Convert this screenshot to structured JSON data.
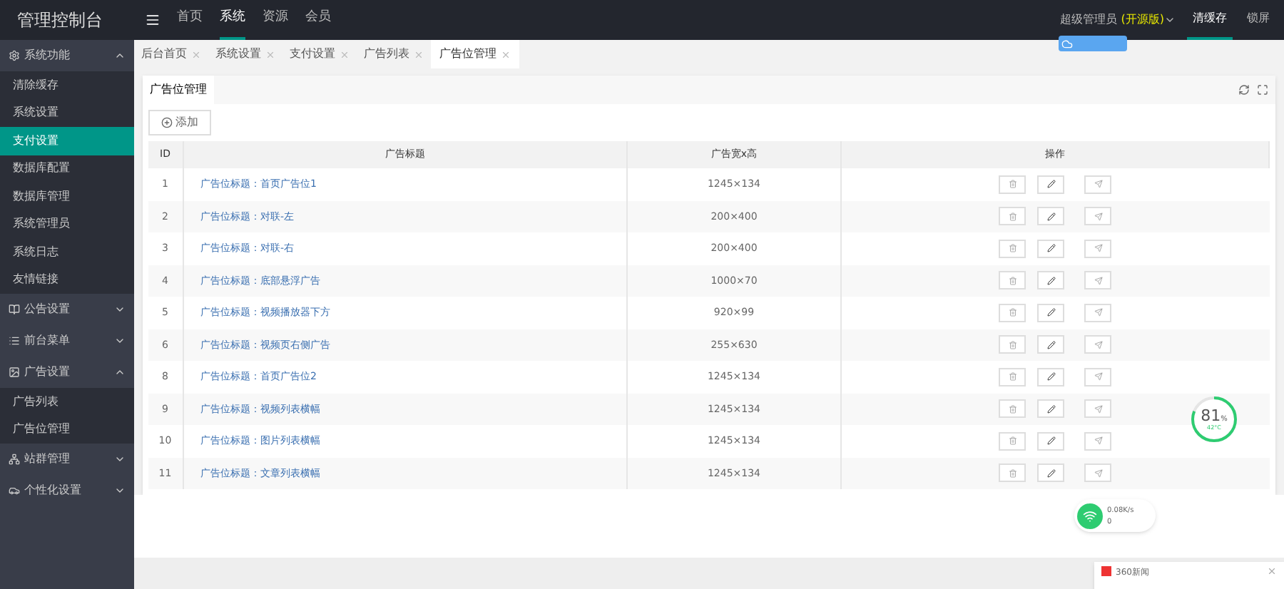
{
  "app_title": "管理控制台",
  "top_nav": [
    {
      "label": "首页",
      "selected": false
    },
    {
      "label": "系统",
      "selected": true
    },
    {
      "label": "资源",
      "selected": false
    },
    {
      "label": "会员",
      "selected": false
    }
  ],
  "user": {
    "name": "超级管理员",
    "edition": "(开源版)"
  },
  "top_actions": [
    {
      "label": "清缓存",
      "selected": true
    },
    {
      "label": "锁屏",
      "selected": false
    }
  ],
  "sidebar": [
    {
      "label": "系统功能",
      "expanded": true,
      "children": [
        {
          "label": "清除缓存",
          "selected": false
        },
        {
          "label": "系统设置",
          "selected": false
        },
        {
          "label": "支付设置",
          "selected": true
        },
        {
          "label": "数据库配置",
          "selected": false
        },
        {
          "label": "数据库管理",
          "selected": false
        },
        {
          "label": "系统管理员",
          "selected": false
        },
        {
          "label": "系统日志",
          "selected": false
        },
        {
          "label": "友情链接",
          "selected": false
        }
      ]
    },
    {
      "label": "公告设置",
      "expanded": false
    },
    {
      "label": "前台菜单",
      "expanded": false
    },
    {
      "label": "广告设置",
      "expanded": true,
      "children": [
        {
          "label": "广告列表",
          "selected": false
        },
        {
          "label": "广告位管理",
          "selected": false
        }
      ]
    },
    {
      "label": "站群管理",
      "expanded": false
    },
    {
      "label": "个性化设置",
      "expanded": false
    }
  ],
  "page_tabs": [
    {
      "label": "后台首页",
      "selected": false
    },
    {
      "label": "系统设置",
      "selected": false
    },
    {
      "label": "支付设置",
      "selected": false
    },
    {
      "label": "广告列表",
      "selected": false
    },
    {
      "label": "广告位管理",
      "selected": true
    }
  ],
  "card_title": "广告位管理",
  "add_button": "添加",
  "table": {
    "columns": [
      "ID",
      "广告标题",
      "广告宽x高",
      "操作"
    ],
    "rows": [
      {
        "id": "1",
        "title": "广告位标题：首页广告位1",
        "size": "1245×134"
      },
      {
        "id": "2",
        "title": "广告位标题：对联-左",
        "size": "200×400"
      },
      {
        "id": "3",
        "title": "广告位标题：对联-右",
        "size": "200×400"
      },
      {
        "id": "4",
        "title": "广告位标题：底部悬浮广告",
        "size": "1000×70"
      },
      {
        "id": "5",
        "title": "广告位标题：视频播放器下方",
        "size": "920×99"
      },
      {
        "id": "6",
        "title": "广告位标题：视频页右侧广告",
        "size": "255×630"
      },
      {
        "id": "8",
        "title": "广告位标题：首页广告位2",
        "size": "1245×134"
      },
      {
        "id": "9",
        "title": "广告位标题：视频列表横幅",
        "size": "1245×134"
      },
      {
        "id": "10",
        "title": "广告位标题：图片列表横幅",
        "size": "1245×134"
      },
      {
        "id": "11",
        "title": "广告位标题：文章列表横幅",
        "size": "1245×134"
      }
    ]
  },
  "cpu_widget": {
    "percent": "81",
    "unit": "%",
    "temperature": "42°C"
  },
  "net_widget": {
    "speed": "0.08K/s",
    "count": "0"
  },
  "news_popup": {
    "title": "360新闻"
  }
}
